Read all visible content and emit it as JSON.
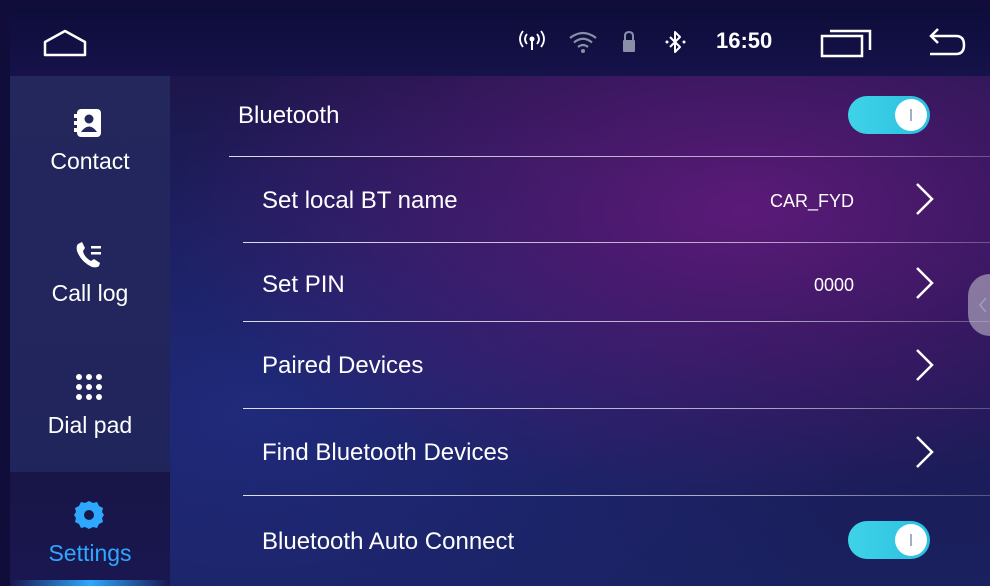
{
  "status_bar": {
    "time": "16:50",
    "icons": [
      "home-icon",
      "signal-icon",
      "wifi-icon",
      "lock-icon",
      "bluetooth-icon",
      "recent-apps-icon",
      "back-icon"
    ]
  },
  "sidebar": {
    "items": [
      {
        "label": "Contact",
        "icon": "contact-icon",
        "active": false
      },
      {
        "label": "Call log",
        "icon": "call-log-icon",
        "active": false
      },
      {
        "label": "Dial pad",
        "icon": "dial-pad-icon",
        "active": false
      },
      {
        "label": "Settings",
        "icon": "gear-icon",
        "active": true
      }
    ]
  },
  "settings": {
    "bluetooth": {
      "label": "Bluetooth",
      "enabled": true
    },
    "rows": [
      {
        "label": "Set local BT name",
        "value": "CAR_FYD"
      },
      {
        "label": "Set PIN",
        "value": "0000"
      },
      {
        "label": "Paired Devices",
        "value": ""
      },
      {
        "label": "Find Bluetooth Devices",
        "value": ""
      }
    ],
    "auto_connect": {
      "label": "Bluetooth Auto Connect",
      "enabled": true
    }
  },
  "colors": {
    "accent": "#2ea8ff",
    "toggle_on": "#3fd3e8",
    "sidebar_bg": "#24275c",
    "background": "#1a1750"
  }
}
